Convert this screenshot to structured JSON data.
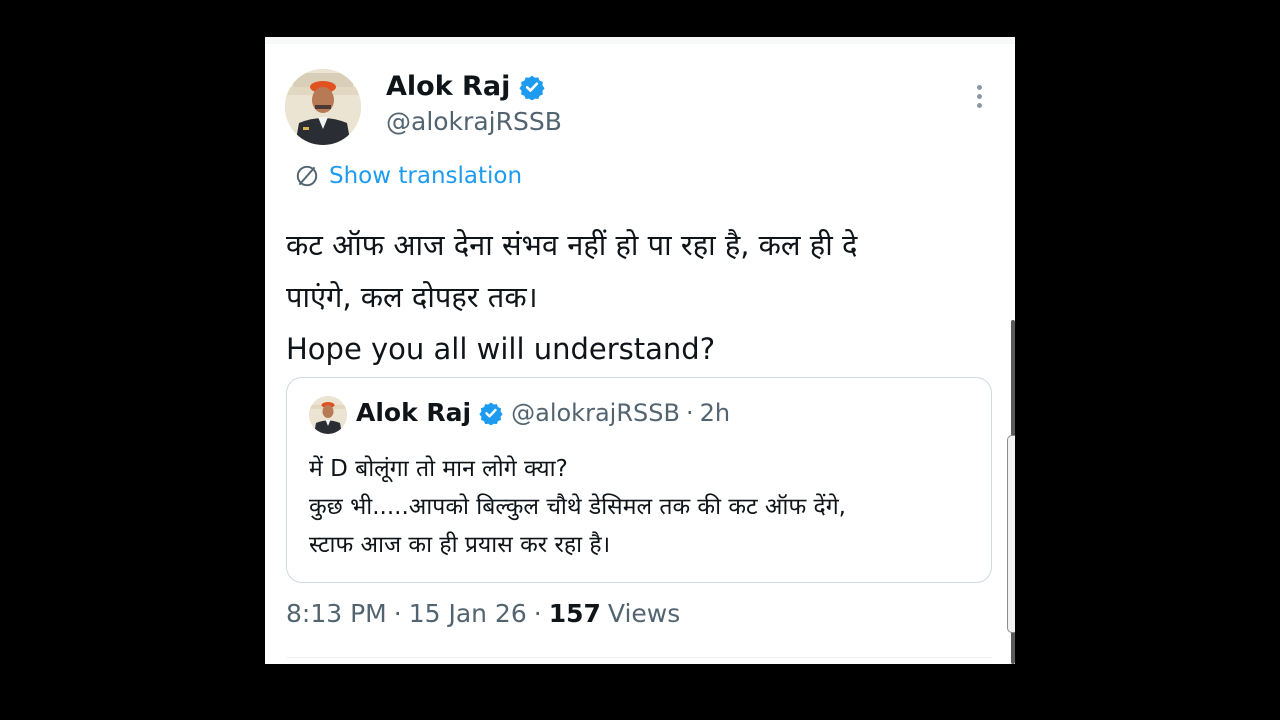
{
  "tweet": {
    "author_name": "Alok Raj",
    "author_handle": "@alokrajRSSB",
    "show_translation_label": "Show translation",
    "body_lines": [
      "कट ऑफ आज देना संभव नहीं हो पा रहा है, कल ही दे",
      "पाएंगे, कल दोपहर तक।",
      "Hope you all will understand?"
    ],
    "time": "8:13 PM",
    "date": "15 Jan 26",
    "views_count": "157",
    "views_label": "Views"
  },
  "quoted_tweet": {
    "author_name": "Alok Raj",
    "author_handle": "@alokrajRSSB",
    "separator": "·",
    "time_ago": "2h",
    "lines": [
      "में D बोलूंगा तो मान लोगे क्या?",
      "कुछ भी.....आपको बिल्कुल चौथे डेसिमल तक की कट ऑफ देंगे,",
      "स्टाफ आज का ही प्रयास कर रहा है।"
    ]
  },
  "meta_separator": "·",
  "icons": {
    "verified": "verified-badge-icon",
    "translate": "translate-icon",
    "more": "more-vertical-icon"
  },
  "colors": {
    "accent": "#1d9bf0",
    "text_primary": "#0f1419",
    "text_secondary": "#536471",
    "border": "#cfd9de",
    "background": "#ffffff",
    "frame": "#000000"
  }
}
